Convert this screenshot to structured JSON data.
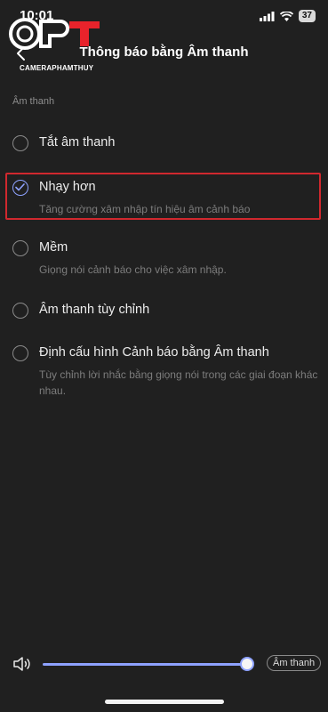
{
  "status": {
    "time": "10:01",
    "battery": "37"
  },
  "logo": {
    "caption": "CAMERAPHAMTHUY"
  },
  "header": {
    "title": "Thông báo bằng Âm thanh"
  },
  "section": {
    "label": "Âm thanh"
  },
  "options": [
    {
      "title": "Tắt âm thanh",
      "desc": "",
      "selected": false
    },
    {
      "title": "Nhạy hơn",
      "desc": "Tăng cường xâm nhập tín hiệu âm cảnh báo",
      "selected": true
    },
    {
      "title": "Mềm",
      "desc": "Giọng nói cảnh báo cho việc xâm nhập.",
      "selected": false
    },
    {
      "title": "Âm thanh tùy chỉnh",
      "desc": "",
      "selected": false
    },
    {
      "title": "Định cấu hình Cảnh báo bằng Âm thanh",
      "desc": "Tùy chỉnh lời nhắc bằng giọng nói trong các giai đoạn khác nhau.",
      "selected": false
    }
  ],
  "volume": {
    "level_percent": 100,
    "chip_label": "Âm thanh"
  },
  "colors": {
    "accent": "#8ea2ff",
    "highlight": "#d0282e",
    "logo_red": "#e8232b"
  }
}
